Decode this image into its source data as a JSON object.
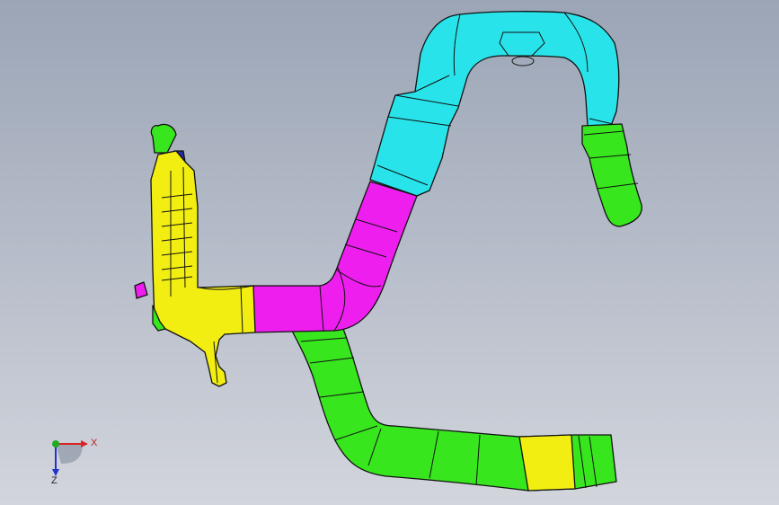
{
  "viewport": {
    "background_top": "#9ba5b6",
    "background_bottom": "#d2d5dc"
  },
  "colors": {
    "yellow": "#f2ee12",
    "magenta": "#ee1fee",
    "cyan": "#29e3ea",
    "green": "#38e61e",
    "outline": "#111111"
  },
  "parts": [
    {
      "name": "reservoir-tank",
      "color": "yellow"
    },
    {
      "name": "pipe-elbow",
      "color": "magenta"
    },
    {
      "name": "upper-connector",
      "color": "cyan"
    },
    {
      "name": "outlet-hose",
      "color": "green"
    },
    {
      "name": "lower-hose",
      "color": "green"
    }
  ],
  "triad": {
    "x_label": "X",
    "z_label": "Z",
    "x_color": "#dd2222",
    "y_color": "#22aa22",
    "z_color": "#2233cc"
  }
}
